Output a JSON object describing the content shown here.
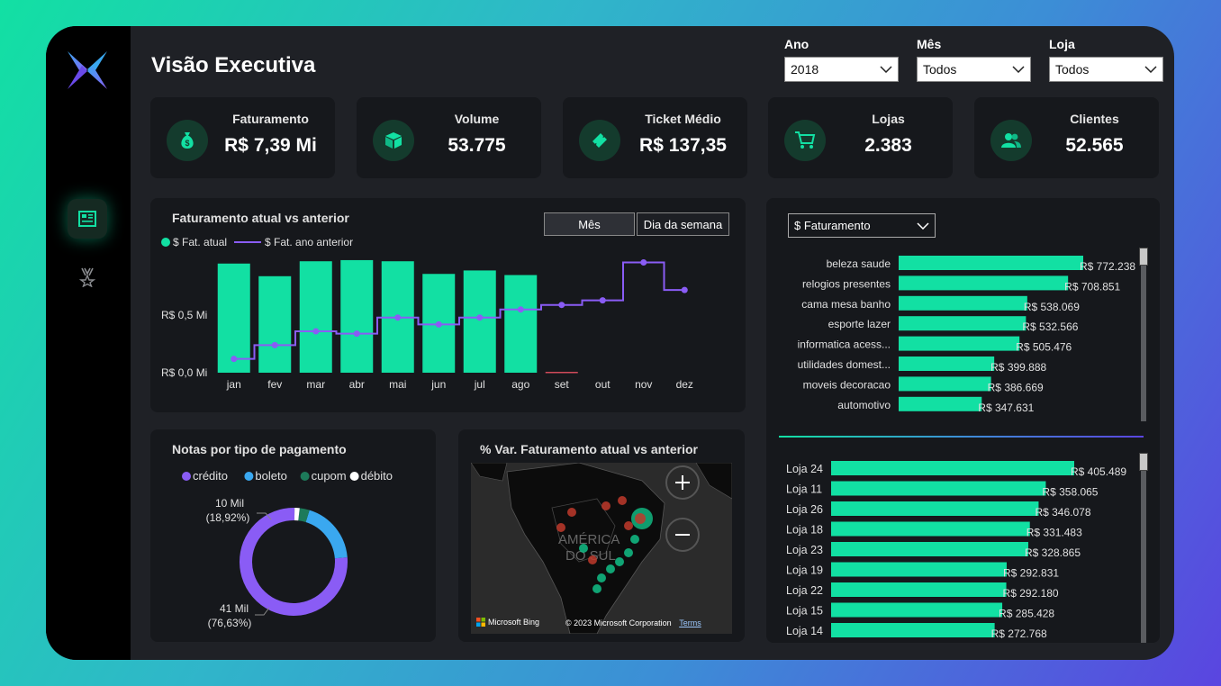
{
  "page": {
    "title": "Visão Executiva"
  },
  "filters": [
    {
      "label": "Ano",
      "value": "2018"
    },
    {
      "label": "Mês",
      "value": "Todos"
    },
    {
      "label": "Loja",
      "value": "Todos"
    }
  ],
  "kpis": [
    {
      "label": "Faturamento",
      "value": "R$ 7,39 Mi",
      "icon": "money-bag-icon"
    },
    {
      "label": "Volume",
      "value": "53.775",
      "icon": "box-icon"
    },
    {
      "label": "Ticket Médio",
      "value": "R$ 137,35",
      "icon": "ticket-icon"
    },
    {
      "label": "Lojas",
      "value": "2.383",
      "icon": "cart-icon"
    },
    {
      "label": "Clientes",
      "value": "52.565",
      "icon": "users-icon"
    }
  ],
  "colors": {
    "accent": "#12e0a3",
    "purple": "#8a5cf5",
    "blue": "#3aa8f0",
    "dark_green": "#1d7a5a",
    "red": "#c0392b"
  },
  "revenue_chart": {
    "title": "Faturamento atual vs anterior",
    "legend": [
      "$ Fat. atual",
      "$ Fat. ano anterior"
    ],
    "toggle": [
      "Mês",
      "Dia da semana"
    ]
  },
  "category_panel": {
    "dropdown": "$ Faturamento"
  },
  "payment_chart": {
    "title": "Notas por tipo de pagamento"
  },
  "map_panel": {
    "title": "% Var. Faturamento atual vs anterior",
    "map_label_line1": "AMÉRICA",
    "map_label_line2": "DO SUL",
    "bing": "Microsoft Bing",
    "copyright": "© 2023 Microsoft Corporation",
    "terms": "Terms"
  },
  "chart_data": [
    {
      "type": "bar",
      "title": "Faturamento atual vs anterior",
      "categories": [
        "jan",
        "fev",
        "mar",
        "abr",
        "mai",
        "jun",
        "jul",
        "ago",
        "set",
        "out",
        "nov",
        "dez"
      ],
      "y_tick_labels": [
        "R$ 0,0 Mi",
        "R$ 0,5 Mi"
      ],
      "ylim": [
        0,
        1.05
      ],
      "series": [
        {
          "name": "$ Fat. atual",
          "type": "bar",
          "values": [
            0.95,
            0.84,
            0.97,
            0.98,
            0.97,
            0.86,
            0.89,
            0.85,
            0.005,
            null,
            null,
            null
          ]
        },
        {
          "name": "$ Fat. ano anterior",
          "type": "step-line",
          "values": [
            0.12,
            0.24,
            0.36,
            0.34,
            0.48,
            0.42,
            0.48,
            0.55,
            0.59,
            0.63,
            0.96,
            0.72
          ]
        }
      ]
    },
    {
      "type": "bar",
      "orientation": "horizontal",
      "categories": [
        "beleza saude",
        "relogios presentes",
        "cama mesa banho",
        "esporte lazer",
        "informatica acess...",
        "utilidades domest...",
        "moveis decoracao",
        "automotivo"
      ],
      "values": [
        772238,
        708851,
        538069,
        532566,
        505476,
        399888,
        386669,
        347631
      ],
      "value_labels": [
        "R$ 772.238",
        "R$ 708.851",
        "R$ 538.069",
        "R$ 532.566",
        "R$ 505.476",
        "R$ 399.888",
        "R$ 386.669",
        "R$ 347.631"
      ]
    },
    {
      "type": "bar",
      "orientation": "horizontal",
      "categories": [
        "Loja 24",
        "Loja 11",
        "Loja 26",
        "Loja 18",
        "Loja 23",
        "Loja 19",
        "Loja 22",
        "Loja 15",
        "Loja 14"
      ],
      "values": [
        405489,
        358065,
        346078,
        331483,
        328865,
        292831,
        292180,
        285428,
        272768
      ],
      "value_labels": [
        "R$ 405.489",
        "R$ 358.065",
        "R$ 346.078",
        "R$ 331.483",
        "R$ 328.865",
        "R$ 292.831",
        "R$ 292.180",
        "R$ 285.428",
        "R$ 272.768"
      ]
    },
    {
      "type": "pie",
      "title": "Notas por tipo de pagamento",
      "labels": [
        "crédito",
        "boleto",
        "cupom",
        "débito"
      ],
      "shares": [
        0.7663,
        0.1892,
        0.0295,
        0.015
      ],
      "colors": [
        "#8a5cf5",
        "#3aa8f0",
        "#1d7a5a",
        "#ffffff"
      ],
      "annotations": [
        {
          "value": "41 Mil",
          "pct": "(76,63%)"
        },
        {
          "value": "10 Mil",
          "pct": "(18,92%)"
        }
      ]
    }
  ]
}
